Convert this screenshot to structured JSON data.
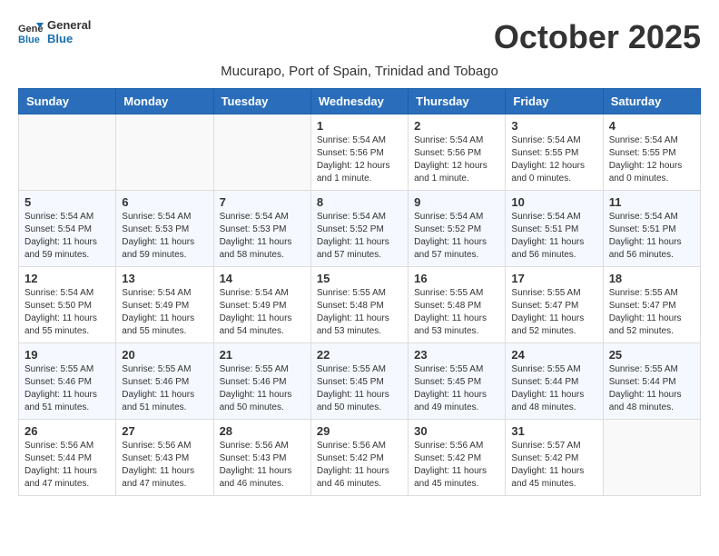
{
  "header": {
    "logo_line1": "General",
    "logo_line2": "Blue",
    "month_title": "October 2025",
    "subtitle": "Mucurapo, Port of Spain, Trinidad and Tobago"
  },
  "weekdays": [
    "Sunday",
    "Monday",
    "Tuesday",
    "Wednesday",
    "Thursday",
    "Friday",
    "Saturday"
  ],
  "weeks": [
    [
      {
        "day": "",
        "info": ""
      },
      {
        "day": "",
        "info": ""
      },
      {
        "day": "",
        "info": ""
      },
      {
        "day": "1",
        "info": "Sunrise: 5:54 AM\nSunset: 5:56 PM\nDaylight: 12 hours\nand 1 minute."
      },
      {
        "day": "2",
        "info": "Sunrise: 5:54 AM\nSunset: 5:56 PM\nDaylight: 12 hours\nand 1 minute."
      },
      {
        "day": "3",
        "info": "Sunrise: 5:54 AM\nSunset: 5:55 PM\nDaylight: 12 hours\nand 0 minutes."
      },
      {
        "day": "4",
        "info": "Sunrise: 5:54 AM\nSunset: 5:55 PM\nDaylight: 12 hours\nand 0 minutes."
      }
    ],
    [
      {
        "day": "5",
        "info": "Sunrise: 5:54 AM\nSunset: 5:54 PM\nDaylight: 11 hours\nand 59 minutes."
      },
      {
        "day": "6",
        "info": "Sunrise: 5:54 AM\nSunset: 5:53 PM\nDaylight: 11 hours\nand 59 minutes."
      },
      {
        "day": "7",
        "info": "Sunrise: 5:54 AM\nSunset: 5:53 PM\nDaylight: 11 hours\nand 58 minutes."
      },
      {
        "day": "8",
        "info": "Sunrise: 5:54 AM\nSunset: 5:52 PM\nDaylight: 11 hours\nand 57 minutes."
      },
      {
        "day": "9",
        "info": "Sunrise: 5:54 AM\nSunset: 5:52 PM\nDaylight: 11 hours\nand 57 minutes."
      },
      {
        "day": "10",
        "info": "Sunrise: 5:54 AM\nSunset: 5:51 PM\nDaylight: 11 hours\nand 56 minutes."
      },
      {
        "day": "11",
        "info": "Sunrise: 5:54 AM\nSunset: 5:51 PM\nDaylight: 11 hours\nand 56 minutes."
      }
    ],
    [
      {
        "day": "12",
        "info": "Sunrise: 5:54 AM\nSunset: 5:50 PM\nDaylight: 11 hours\nand 55 minutes."
      },
      {
        "day": "13",
        "info": "Sunrise: 5:54 AM\nSunset: 5:49 PM\nDaylight: 11 hours\nand 55 minutes."
      },
      {
        "day": "14",
        "info": "Sunrise: 5:54 AM\nSunset: 5:49 PM\nDaylight: 11 hours\nand 54 minutes."
      },
      {
        "day": "15",
        "info": "Sunrise: 5:55 AM\nSunset: 5:48 PM\nDaylight: 11 hours\nand 53 minutes."
      },
      {
        "day": "16",
        "info": "Sunrise: 5:55 AM\nSunset: 5:48 PM\nDaylight: 11 hours\nand 53 minutes."
      },
      {
        "day": "17",
        "info": "Sunrise: 5:55 AM\nSunset: 5:47 PM\nDaylight: 11 hours\nand 52 minutes."
      },
      {
        "day": "18",
        "info": "Sunrise: 5:55 AM\nSunset: 5:47 PM\nDaylight: 11 hours\nand 52 minutes."
      }
    ],
    [
      {
        "day": "19",
        "info": "Sunrise: 5:55 AM\nSunset: 5:46 PM\nDaylight: 11 hours\nand 51 minutes."
      },
      {
        "day": "20",
        "info": "Sunrise: 5:55 AM\nSunset: 5:46 PM\nDaylight: 11 hours\nand 51 minutes."
      },
      {
        "day": "21",
        "info": "Sunrise: 5:55 AM\nSunset: 5:46 PM\nDaylight: 11 hours\nand 50 minutes."
      },
      {
        "day": "22",
        "info": "Sunrise: 5:55 AM\nSunset: 5:45 PM\nDaylight: 11 hours\nand 50 minutes."
      },
      {
        "day": "23",
        "info": "Sunrise: 5:55 AM\nSunset: 5:45 PM\nDaylight: 11 hours\nand 49 minutes."
      },
      {
        "day": "24",
        "info": "Sunrise: 5:55 AM\nSunset: 5:44 PM\nDaylight: 11 hours\nand 48 minutes."
      },
      {
        "day": "25",
        "info": "Sunrise: 5:55 AM\nSunset: 5:44 PM\nDaylight: 11 hours\nand 48 minutes."
      }
    ],
    [
      {
        "day": "26",
        "info": "Sunrise: 5:56 AM\nSunset: 5:44 PM\nDaylight: 11 hours\nand 47 minutes."
      },
      {
        "day": "27",
        "info": "Sunrise: 5:56 AM\nSunset: 5:43 PM\nDaylight: 11 hours\nand 47 minutes."
      },
      {
        "day": "28",
        "info": "Sunrise: 5:56 AM\nSunset: 5:43 PM\nDaylight: 11 hours\nand 46 minutes."
      },
      {
        "day": "29",
        "info": "Sunrise: 5:56 AM\nSunset: 5:42 PM\nDaylight: 11 hours\nand 46 minutes."
      },
      {
        "day": "30",
        "info": "Sunrise: 5:56 AM\nSunset: 5:42 PM\nDaylight: 11 hours\nand 45 minutes."
      },
      {
        "day": "31",
        "info": "Sunrise: 5:57 AM\nSunset: 5:42 PM\nDaylight: 11 hours\nand 45 minutes."
      },
      {
        "day": "",
        "info": ""
      }
    ]
  ]
}
